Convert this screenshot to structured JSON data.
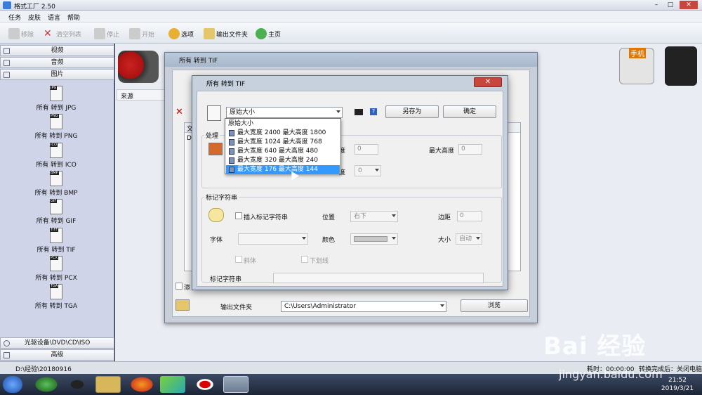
{
  "app": {
    "title": "格式工厂 2.50"
  },
  "menu": [
    "任务",
    "皮肤",
    "语言",
    "帮助"
  ],
  "toolbar": {
    "remove": "移除",
    "clear": "清空列表",
    "stop": "停止",
    "start": "开始",
    "options": "选项",
    "output_folder": "输出文件夹",
    "home": "主页"
  },
  "sidebar": {
    "video": "视频",
    "audio": "音频",
    "image": "图片",
    "formats": [
      {
        "badge": "JPG",
        "label": "所有 转到 JPG"
      },
      {
        "badge": "PNG",
        "label": "所有 转到 PNG"
      },
      {
        "badge": "ICO",
        "label": "所有 转到 ICO"
      },
      {
        "badge": "BMP",
        "label": "所有 转到 BMP"
      },
      {
        "badge": "GIF",
        "label": "所有 转到 GIF"
      },
      {
        "badge": "TIFF",
        "label": "所有 转到 TIF"
      },
      {
        "badge": "PCX",
        "label": "所有 转到 PCX"
      },
      {
        "badge": "TGA",
        "label": "所有 转到 TGA"
      }
    ],
    "optical": "光驱设备\\DVD\\CD\\ISO",
    "advanced": "高级"
  },
  "main": {
    "source_header": "来源",
    "phone_label": "手机"
  },
  "back_window": {
    "title": "所有 转到 TIF",
    "file_col": "文件",
    "file_row": "D",
    "add_label": "添",
    "output_folder_label": "输出文件夹",
    "output_path": "C:\\Users\\Administrator",
    "browse": "浏览"
  },
  "dialog": {
    "title": "所有 转到 TIF",
    "close": "✕",
    "size_selected": "原始大小",
    "save_as": "另存为",
    "ok": "确定",
    "process_label": "处理",
    "max_width_suffix": "度",
    "max_height": "最大高度",
    "max_width_value": "0",
    "max_height_value": "0",
    "rotate_suffix": "度",
    "rotate_value": "0",
    "mark_group": "标记字符串",
    "insert_mark": "插入标记字符串",
    "position": "位置",
    "position_value": "右下",
    "margin": "边距",
    "margin_value": "0",
    "font": "字体",
    "color": "颜色",
    "size": "大小",
    "size_value": "自动",
    "italic": "斜体",
    "underline": "下划线",
    "mark_string": "标记字符串",
    "dropdown": [
      "原始大小",
      "最大宽度 2400 最大高度 1800",
      "最大宽度 1024 最大高度 768",
      "最大宽度 640 最大高度 480",
      "最大宽度 320 最大高度 240",
      "最大宽度 176 最大高度 144"
    ],
    "dropdown_selected": 5
  },
  "status": {
    "path": "D:\\经验\\20180916",
    "right": "耗时：00:00:00",
    "after": "转换完成后：关闭电脑"
  },
  "clock": {
    "time": "21:52",
    "date": "2019/3/21"
  },
  "watermark": {
    "brand": "Bai 经验",
    "url": "jingyan.baidu.com"
  }
}
